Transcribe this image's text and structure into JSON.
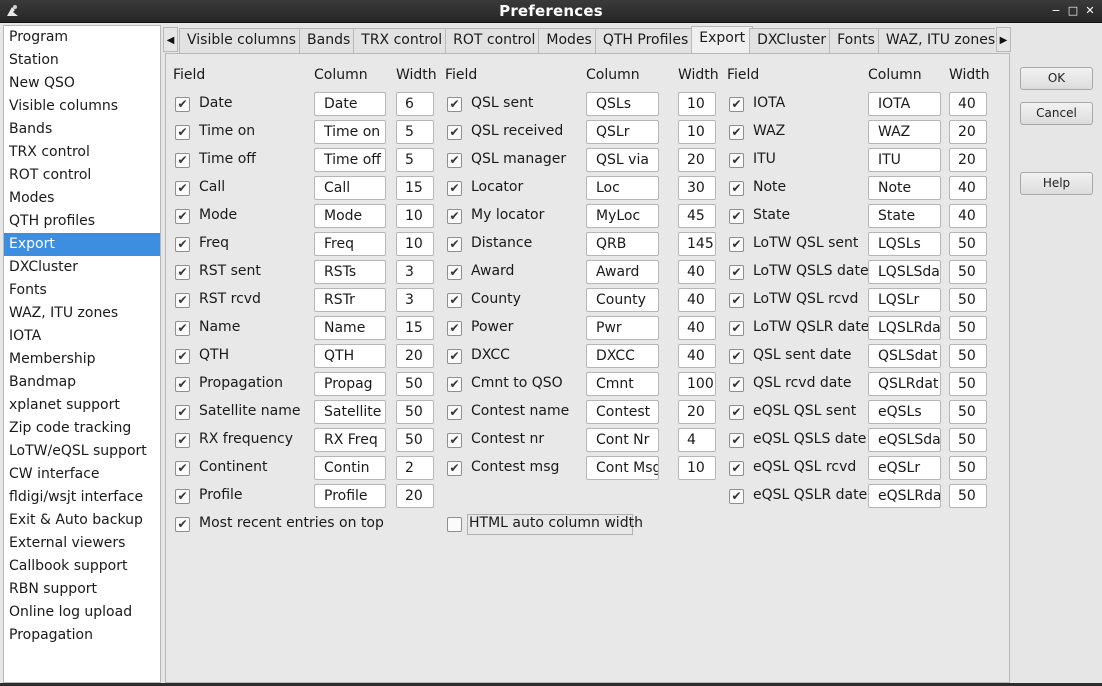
{
  "window": {
    "title": "Preferences",
    "min_glyph": "−",
    "max_glyph": "□",
    "close_glyph": "✕"
  },
  "nav": {
    "items": [
      {
        "label": "Program"
      },
      {
        "label": "Station"
      },
      {
        "label": "New QSO"
      },
      {
        "label": "Visible columns"
      },
      {
        "label": "Bands"
      },
      {
        "label": "TRX control"
      },
      {
        "label": "ROT control"
      },
      {
        "label": "Modes"
      },
      {
        "label": "QTH profiles"
      },
      {
        "label": "Export"
      },
      {
        "label": "DXCluster"
      },
      {
        "label": "Fonts"
      },
      {
        "label": "WAZ, ITU zones"
      },
      {
        "label": "IOTA"
      },
      {
        "label": "Membership"
      },
      {
        "label": "Bandmap"
      },
      {
        "label": "xplanet support"
      },
      {
        "label": "Zip code tracking"
      },
      {
        "label": "LoTW/eQSL support"
      },
      {
        "label": "CW interface"
      },
      {
        "label": "fldigi/wsjt interface"
      },
      {
        "label": "Exit & Auto backup"
      },
      {
        "label": "External viewers"
      },
      {
        "label": "Callbook support"
      },
      {
        "label": "RBN support"
      },
      {
        "label": "Online log upload"
      },
      {
        "label": "Propagation"
      }
    ],
    "selected": "Export",
    "selected_color": "#3d8ee0"
  },
  "tabs": {
    "left_arrow": "◀",
    "right_arrow": "▶",
    "items": [
      "Visible columns",
      "Bands",
      "TRX control",
      "ROT control",
      "Modes",
      "QTH Profiles",
      "Export",
      "DXCluster",
      "Fonts",
      "WAZ, ITU zones"
    ],
    "active": "Export"
  },
  "headers": {
    "field": "Field",
    "column": "Column",
    "width": "Width"
  },
  "check_glyph": "✔",
  "columns": [
    [
      {
        "field": "Date",
        "column": "Date",
        "width": "6",
        "checked": true
      },
      {
        "field": "Time on",
        "column": "Time on",
        "width": "5",
        "checked": true
      },
      {
        "field": "Time off",
        "column": "Time off",
        "width": "5",
        "checked": true
      },
      {
        "field": "Call",
        "column": "Call",
        "width": "15",
        "checked": true
      },
      {
        "field": "Mode",
        "column": "Mode",
        "width": "10",
        "checked": true
      },
      {
        "field": "Freq",
        "column": "Freq",
        "width": "10",
        "checked": true
      },
      {
        "field": "RST sent",
        "column": "RSTs",
        "width": "3",
        "checked": true
      },
      {
        "field": "RST rcvd",
        "column": "RSTr",
        "width": "3",
        "checked": true
      },
      {
        "field": "Name",
        "column": "Name",
        "width": "15",
        "checked": true
      },
      {
        "field": "QTH",
        "column": "QTH",
        "width": "20",
        "checked": true
      },
      {
        "field": "Propagation",
        "column": "Propag",
        "width": "50",
        "checked": true
      },
      {
        "field": "Satellite name",
        "column": "Satellite",
        "width": "50",
        "checked": true
      },
      {
        "field": "RX frequency",
        "column": "RX Freq",
        "width": "50",
        "checked": true
      },
      {
        "field": "Continent",
        "column": "Contin",
        "width": "2",
        "checked": true
      },
      {
        "field": "Profile",
        "column": "Profile",
        "width": "20",
        "checked": true
      }
    ],
    [
      {
        "field": "QSL sent",
        "column": "QSLs",
        "width": "10",
        "checked": true
      },
      {
        "field": "QSL received",
        "column": "QSLr",
        "width": "10",
        "checked": true
      },
      {
        "field": "QSL manager",
        "column": "QSL via",
        "width": "20",
        "checked": true
      },
      {
        "field": "Locator",
        "column": "Loc",
        "width": "30",
        "checked": true
      },
      {
        "field": "My locator",
        "column": "MyLoc",
        "width": "45",
        "checked": true
      },
      {
        "field": "Distance",
        "column": "QRB",
        "width": "145",
        "checked": true
      },
      {
        "field": "Award",
        "column": "Award",
        "width": "40",
        "checked": true
      },
      {
        "field": "County",
        "column": "County",
        "width": "40",
        "checked": true
      },
      {
        "field": "Power",
        "column": "Pwr",
        "width": "40",
        "checked": true
      },
      {
        "field": "DXCC",
        "column": "DXCC",
        "width": "40",
        "checked": true
      },
      {
        "field": "Cmnt to QSO",
        "column": "Cmnt",
        "width": "100",
        "checked": true
      },
      {
        "field": "Contest name",
        "column": "Contest",
        "width": "20",
        "checked": true
      },
      {
        "field": "Contest nr",
        "column": "Cont Nr",
        "width": "4",
        "checked": true
      },
      {
        "field": "Contest msg",
        "column": "Cont Msg",
        "width": "10",
        "checked": true
      }
    ],
    [
      {
        "field": "IOTA",
        "column": "IOTA",
        "width": "40",
        "checked": true
      },
      {
        "field": "WAZ",
        "column": "WAZ",
        "width": "20",
        "checked": true
      },
      {
        "field": "ITU",
        "column": "ITU",
        "width": "20",
        "checked": true
      },
      {
        "field": "Note",
        "column": "Note",
        "width": "40",
        "checked": true
      },
      {
        "field": "State",
        "column": "State",
        "width": "40",
        "checked": true
      },
      {
        "field": "LoTW QSL sent",
        "column": "LQSLs",
        "width": "50",
        "checked": true
      },
      {
        "field": "LoTW QSLS date",
        "column": "LQSLSdat",
        "width": "50",
        "checked": true
      },
      {
        "field": "LoTW QSL rcvd",
        "column": "LQSLr",
        "width": "50",
        "checked": true
      },
      {
        "field": "LoTW QSLR date",
        "column": "LQSLRdat",
        "width": "50",
        "checked": true
      },
      {
        "field": "QSL sent date",
        "column": "QSLSdat",
        "width": "50",
        "checked": true
      },
      {
        "field": "QSL rcvd date",
        "column": "QSLRdat",
        "width": "50",
        "checked": true
      },
      {
        "field": "eQSL QSL sent",
        "column": "eQSLs",
        "width": "50",
        "checked": true
      },
      {
        "field": "eQSL QSLS date",
        "column": "eQSLSdat",
        "width": "50",
        "checked": true
      },
      {
        "field": "eQSL QSL rcvd",
        "column": "eQSLr",
        "width": "50",
        "checked": true
      },
      {
        "field": "eQSL QSLR date",
        "column": "eQSLRdat",
        "width": "50",
        "checked": true
      }
    ]
  ],
  "options": {
    "most_recent_on_top": {
      "label": "Most recent entries on top",
      "checked": true
    },
    "html_auto_width": {
      "label": "HTML auto column width",
      "checked": false
    }
  },
  "buttons": {
    "ok": "OK",
    "cancel": "Cancel",
    "help": "Help"
  }
}
